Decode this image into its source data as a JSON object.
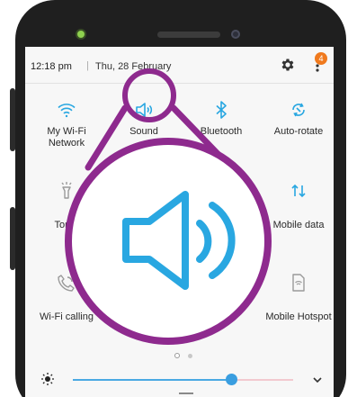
{
  "status": {
    "time": "12:18 pm",
    "separator": "|",
    "date": "Thu, 28 February",
    "notification_badge": "4"
  },
  "tiles": [
    {
      "label": "My Wi-Fi Network",
      "icon": "wifi-icon",
      "active": true
    },
    {
      "label": "Sound",
      "icon": "sound-icon",
      "active": true
    },
    {
      "label": "Bluetooth",
      "icon": "bluetooth-icon",
      "active": true
    },
    {
      "label": "Auto-rotate",
      "icon": "rotate-icon",
      "active": true
    },
    {
      "label": "Torch",
      "icon": "torch-icon",
      "active": false
    },
    {
      "label": "Mobile data",
      "icon": "mobile-data-icon",
      "active": true
    },
    {
      "label": "Wi-Fi calling",
      "icon": "wifi-call-icon",
      "active": false
    },
    {
      "label": "Mobile Hotspot",
      "icon": "hotspot-icon",
      "active": false
    }
  ],
  "brightness": {
    "level": 0.72
  },
  "page_indicator": {
    "current": 1,
    "total": 2
  },
  "colors": {
    "accent": "#29a7e1",
    "magnifier_ring": "#8e2a8e",
    "badge": "#f07a1e",
    "inactive_icon": "#9a9a9a"
  }
}
